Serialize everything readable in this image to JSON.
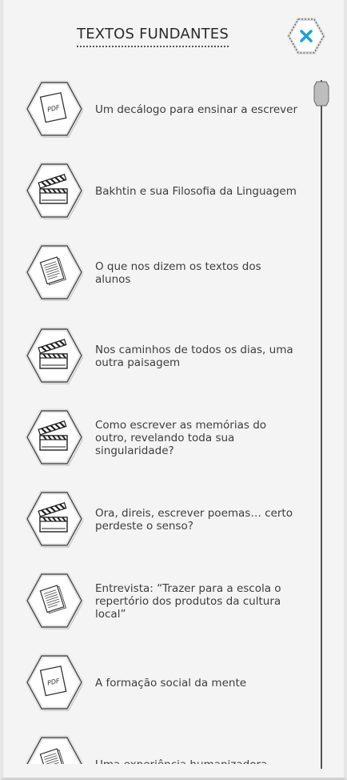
{
  "header": {
    "title": "TEXTOS FUNDANTES",
    "close_icon": "close-x-icon",
    "close_color": "#1aa3d9"
  },
  "items": [
    {
      "label": "Um decálogo para ensinar a escrever",
      "icon": "pdf-icon"
    },
    {
      "label": "Bakhtin e sua Filosofia da Linguagem",
      "icon": "clapperboard-icon"
    },
    {
      "label": "O que nos dizem os textos dos alunos",
      "icon": "document-icon"
    },
    {
      "label": "Nos caminhos de todos os dias, uma outra paisagem",
      "icon": "clapperboard-icon"
    },
    {
      "label": "Como escrever as memórias do outro, revelando toda sua singularidade?",
      "icon": "clapperboard-icon"
    },
    {
      "label": "Ora, direis, escrever poemas… certo perdeste o senso?",
      "icon": "clapperboard-icon"
    },
    {
      "label": "Entrevista: “Trazer para a escola o repertório dos produtos da cultura local”",
      "icon": "document-icon"
    },
    {
      "label": "A formação social da mente",
      "icon": "pdf-icon"
    },
    {
      "label": "Uma experiência humanizadora",
      "icon": "document-icon"
    }
  ]
}
